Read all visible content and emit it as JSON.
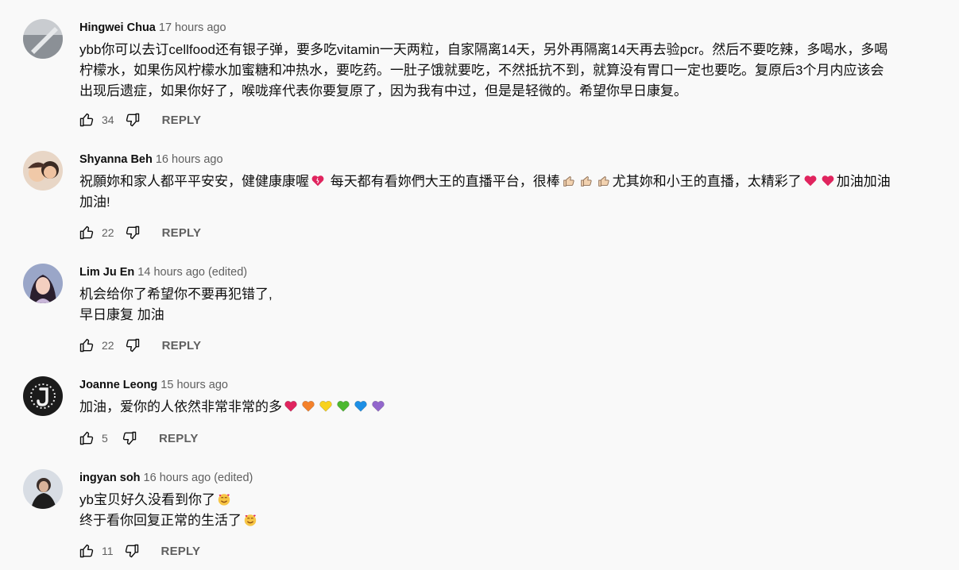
{
  "comments": [
    {
      "author": "Hingwei Chua",
      "time": "17 hours ago",
      "lines": [
        "ybb你可以去订cellfood还有银子弹，要多吃vitamin一天两粒，自家隔离14天，另外再隔离14天再去验pcr。然后不要吃辣，多喝水，多喝",
        "柠檬水，如果伤风柠檬水加蜜糖和冲热水，要吃药。一肚子饿就要吃，不然抵抗不到，就算没有胃口一定也要吃。复原后3个月内应该会",
        "出现后遗症，如果你好了，喉咙痒代表你要复原了，因为我有中过，但是是轻微的。希望你早日康复。"
      ],
      "likes": "34",
      "reply_label": "REPLY"
    },
    {
      "author": "Shyanna Beh",
      "time": "16 hours ago",
      "line1_a": "祝願妳和家人都平平安安，健健康康喔",
      "line1_b": " 每天都有看妳們大王的直播平台，很棒",
      "line1_c": "尤其妳和小王的直播，太精彩了",
      "line1_d": "加油加油",
      "line2": "加油!",
      "likes": "22",
      "reply_label": "REPLY"
    },
    {
      "author": "Lim Ju En",
      "time": "14 hours ago (edited)",
      "lines": [
        "机会给你了希望你不要再犯错了,",
        "早日康复 加油"
      ],
      "likes": "22",
      "reply_label": "REPLY"
    },
    {
      "author": "Joanne Leong",
      "time": "15 hours ago",
      "text": "加油，爱你的人依然非常非常的多",
      "hearts": [
        "#e0245e",
        "#f4812a",
        "#f8d21d",
        "#4cb82f",
        "#1d8fe5",
        "#9266cc"
      ],
      "likes": "5",
      "reply_label": "REPLY"
    },
    {
      "author": "ingyan soh",
      "time": "16 hours ago (edited)",
      "line1": "yb宝贝好久没看到你了",
      "line2": "终于看你回复正常的生活了",
      "likes": "11",
      "reply_label": "REPLY"
    }
  ],
  "icons": {
    "like": "thumbs-up-icon",
    "dislike": "thumbs-down-icon",
    "avatar_emojis": [
      "heart-emoji",
      "thumbs-up-emoji",
      "smiling-face-with-hearts-emoji"
    ]
  }
}
